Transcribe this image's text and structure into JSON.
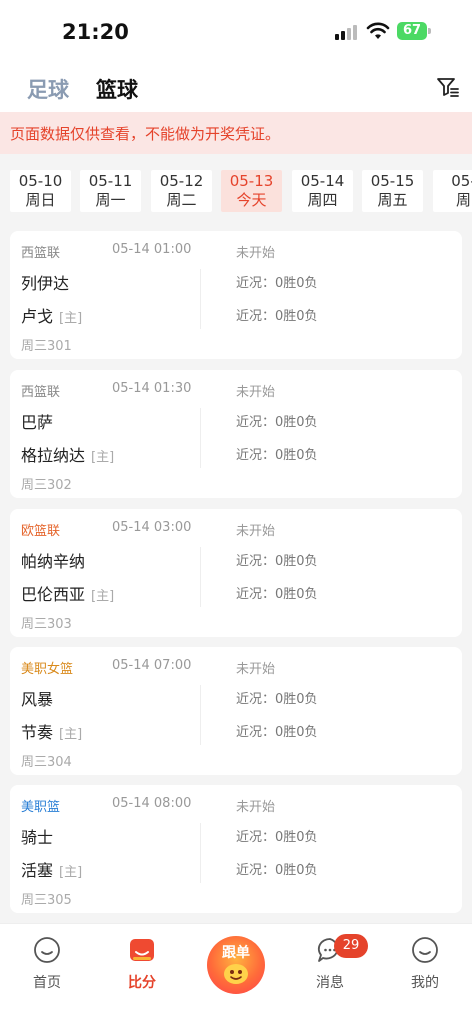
{
  "status_bar": {
    "time": "21:20",
    "battery": "67"
  },
  "header": {
    "tabs": [
      "足球",
      "篮球"
    ]
  },
  "notice": "页面数据仅供查看，不能做为开奖凭证。",
  "dates": [
    {
      "date": "05-10",
      "weekday": "周日"
    },
    {
      "date": "05-11",
      "weekday": "周一"
    },
    {
      "date": "05-12",
      "weekday": "周二"
    },
    {
      "date": "05-13",
      "weekday": "今天"
    },
    {
      "date": "05-14",
      "weekday": "周四"
    },
    {
      "date": "05-15",
      "weekday": "周五"
    },
    {
      "date": "05-",
      "weekday": "周"
    }
  ],
  "matches": [
    {
      "league": "西篮联",
      "league_color": "#888888",
      "time": "05-14 01:00",
      "status": "未开始",
      "home": "列伊达",
      "away": "卢戈",
      "host": "[主]",
      "record_home": "近况：0胜0负",
      "record_away": "近况：0胜0负",
      "number": "周三301"
    },
    {
      "league": "西篮联",
      "league_color": "#888888",
      "time": "05-14 01:30",
      "status": "未开始",
      "home": "巴萨",
      "away": "格拉纳达",
      "host": "[主]",
      "record_home": "近况：0胜0负",
      "record_away": "近况：0胜0负",
      "number": "周三302"
    },
    {
      "league": "欧篮联",
      "league_color": "#e5642b",
      "time": "05-14 03:00",
      "status": "未开始",
      "home": "帕纳辛纳",
      "away": "巴伦西亚",
      "host": "[主]",
      "record_home": "近况：0胜0负",
      "record_away": "近况：0胜0负",
      "number": "周三303"
    },
    {
      "league": "美职女篮",
      "league_color": "#d98a1c",
      "time": "05-14 07:00",
      "status": "未开始",
      "home": "风暴",
      "away": "节奏",
      "host": "[主]",
      "record_home": "近况：0胜0负",
      "record_away": "近况：0胜0负",
      "number": "周三304"
    },
    {
      "league": "美职篮",
      "league_color": "#2a7fd6",
      "time": "05-14 08:00",
      "status": "未开始",
      "home": "骑士",
      "away": "活塞",
      "host": "[主]",
      "record_home": "近况：0胜0负",
      "record_away": "近况：0胜0负",
      "number": "周三305"
    }
  ],
  "nav": {
    "home": "首页",
    "score": "比分",
    "follow": "跟单",
    "messages": "消息",
    "messages_badge": "29",
    "mine": "我的"
  }
}
